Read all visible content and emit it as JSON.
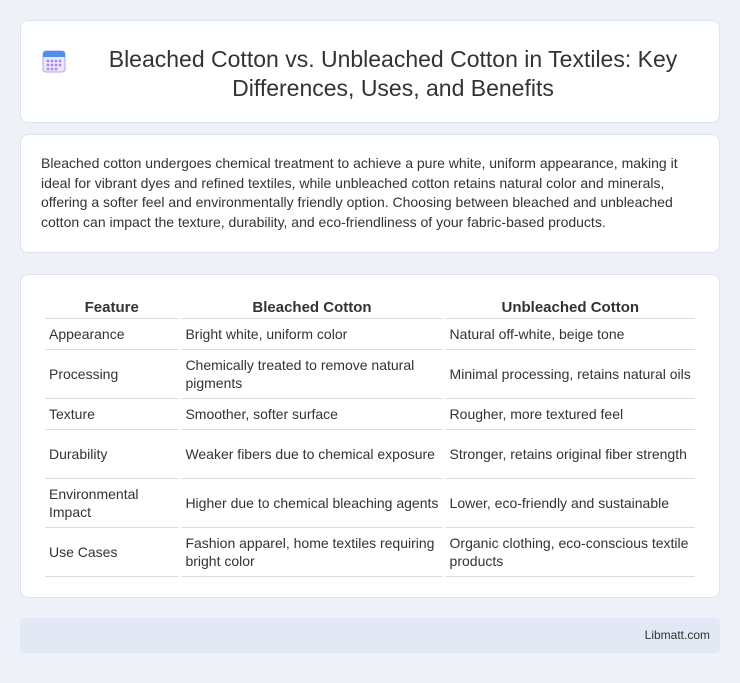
{
  "header": {
    "icon": "calendar-icon",
    "title": "Bleached Cotton vs. Unbleached Cotton in Textiles: Key Differences, Uses, and Benefits"
  },
  "intro": {
    "text": "Bleached cotton undergoes chemical treatment to achieve a pure white, uniform appearance, making it ideal for vibrant dyes and refined textiles, while unbleached cotton retains natural color and minerals, offering a softer feel and environmentally friendly option. Choosing between bleached and unbleached cotton can impact the texture, durability, and eco-friendliness of your fabric-based products."
  },
  "table": {
    "headers": [
      "Feature",
      "Bleached Cotton",
      "Unbleached Cotton"
    ],
    "rows": [
      [
        "Appearance",
        "Bright white, uniform color",
        "Natural off-white, beige tone"
      ],
      [
        "Processing",
        "Chemically treated to remove natural pigments",
        "Minimal processing, retains natural oils"
      ],
      [
        "Texture",
        "Smoother, softer surface",
        "Rougher, more textured feel"
      ],
      [
        "Durability",
        "Weaker fibers due to chemical exposure",
        "Stronger, retains original fiber strength"
      ],
      [
        "Environmental Impact",
        "Higher due to chemical bleaching agents",
        "Lower, eco-friendly and sustainable"
      ],
      [
        "Use Cases",
        "Fashion apparel, home textiles requiring bright color",
        "Organic clothing, eco-conscious textile products"
      ]
    ]
  },
  "footer": {
    "text": "Libmatt.com"
  },
  "colors": {
    "background": "#eef2f8",
    "card": "#ffffff",
    "footer": "#e3e9f4",
    "icon_accent": "#a88be8"
  }
}
